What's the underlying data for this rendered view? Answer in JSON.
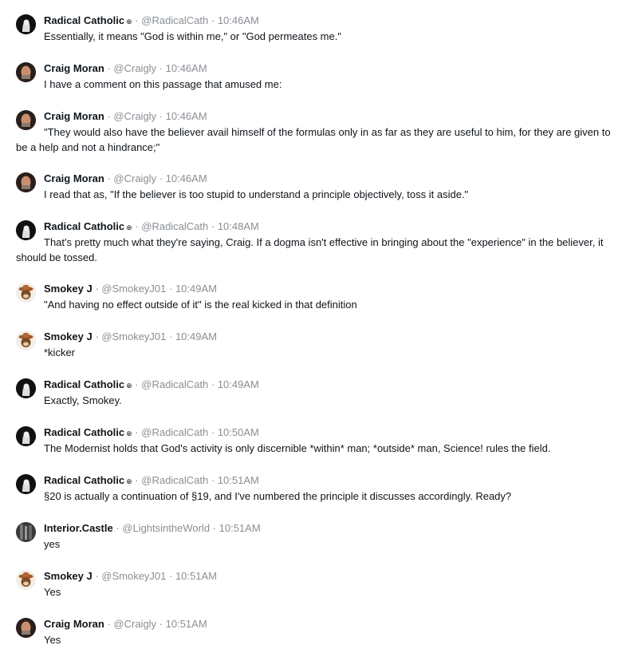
{
  "messages": [
    {
      "author": "Radical Catholic",
      "badge": "⊕",
      "handle": "@RadicalCath",
      "time": "10:46AM",
      "text": "Essentially, it means \"God is within me,\" or \"God permeates me.\"",
      "avatar": "radical-catholic"
    },
    {
      "author": "Craig Moran",
      "badge": "",
      "handle": "@Craigly",
      "time": "10:46AM",
      "text": "I have a comment on this passage that amused me:",
      "avatar": "craig-moran"
    },
    {
      "author": "Craig Moran",
      "badge": "",
      "handle": "@Craigly",
      "time": "10:46AM",
      "text": "\"They would also have the believer avail himself of the formulas only in as far as they are useful to him, for they are given to be a help and not a hindrance;\"",
      "avatar": "craig-moran"
    },
    {
      "author": "Craig Moran",
      "badge": "",
      "handle": "@Craigly",
      "time": "10:46AM",
      "text": "I read that as, \"If the believer is too stupid to understand a principle objectively, toss it aside.\"",
      "avatar": "craig-moran"
    },
    {
      "author": "Radical Catholic",
      "badge": "⊕",
      "handle": "@RadicalCath",
      "time": "10:48AM",
      "text": "That's pretty much what they're saying, Craig. If a dogma isn't effective in bringing about the \"experience\" in the believer, it should be tossed.",
      "avatar": "radical-catholic"
    },
    {
      "author": "Smokey J",
      "badge": "",
      "handle": "@SmokeyJ01",
      "time": "10:49AM",
      "text": "\"And having no effect outside of it\" is the real kicked in that definition",
      "avatar": "smokey-j"
    },
    {
      "author": "Smokey J",
      "badge": "",
      "handle": "@SmokeyJ01",
      "time": "10:49AM",
      "text": "*kicker",
      "avatar": "smokey-j"
    },
    {
      "author": "Radical Catholic",
      "badge": "⊕",
      "handle": "@RadicalCath",
      "time": "10:49AM",
      "text": "Exactly, Smokey.",
      "avatar": "radical-catholic"
    },
    {
      "author": "Radical Catholic",
      "badge": "⊕",
      "handle": "@RadicalCath",
      "time": "10:50AM",
      "text": "The Modernist holds that God's activity is only discernible *within* man; *outside* man, Science! rules the field.",
      "avatar": "radical-catholic"
    },
    {
      "author": "Radical Catholic",
      "badge": "⊕",
      "handle": "@RadicalCath",
      "time": "10:51AM",
      "text": "§20 is actually a continuation of §19, and I've numbered the principle it discusses accordingly. Ready?",
      "avatar": "radical-catholic"
    },
    {
      "author": "Interior.Castle",
      "badge": "",
      "handle": "@LightsintheWorld",
      "time": "10:51AM",
      "text": "yes",
      "avatar": "interior-castle"
    },
    {
      "author": "Smokey J",
      "badge": "",
      "handle": "@SmokeyJ01",
      "time": "10:51AM",
      "text": "Yes",
      "avatar": "smokey-j"
    },
    {
      "author": "Craig Moran",
      "badge": "",
      "handle": "@Craigly",
      "time": "10:51AM",
      "text": "Yes",
      "avatar": "craig-moran"
    }
  ],
  "separator": " · "
}
